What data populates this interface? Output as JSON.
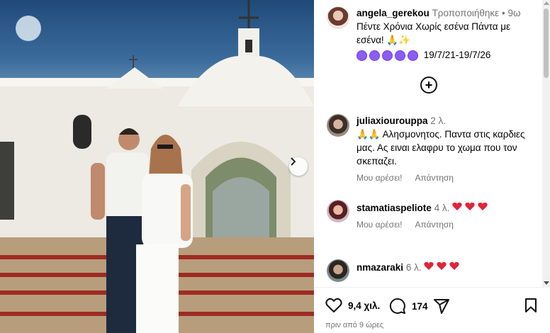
{
  "post": {
    "username": "angela_gerekou",
    "edited_label": "Τροποποιήθηκε",
    "separator": "•",
    "age": "9ω",
    "caption_line1": "Πέντε Χρόνια Χωρίς εσένα Πάντα με εσένα! 🙏✨",
    "dates": "19/7/21-19/7/26",
    "purple_heart_count": 5
  },
  "comments": [
    {
      "username": "juliaxiourouppa",
      "age": "2 λ.",
      "text": "🙏🙏 Αλησμονητος. Παντα στις καρδιες μας. Ας ειναι ελαφρυ το χωμα που τον σκεπαζει.",
      "like_label": "Μου αρέσει!",
      "reply_label": "Απάντηση"
    },
    {
      "username": "stamatiaspeliote",
      "age": "4 λ.",
      "hearts": 3,
      "like_label": "Μου αρέσει!",
      "reply_label": "Απάντηση"
    },
    {
      "username": "nmazaraki",
      "age": "6 λ.",
      "hearts": 3
    }
  ],
  "actions": {
    "likes": "9,4 χιλ.",
    "comments": "174",
    "time_ago": "πριν από 9 ώρες"
  },
  "icons": [
    "heart-icon",
    "comment-icon",
    "share-icon",
    "save-icon",
    "add-icon",
    "chevron-right-icon"
  ]
}
